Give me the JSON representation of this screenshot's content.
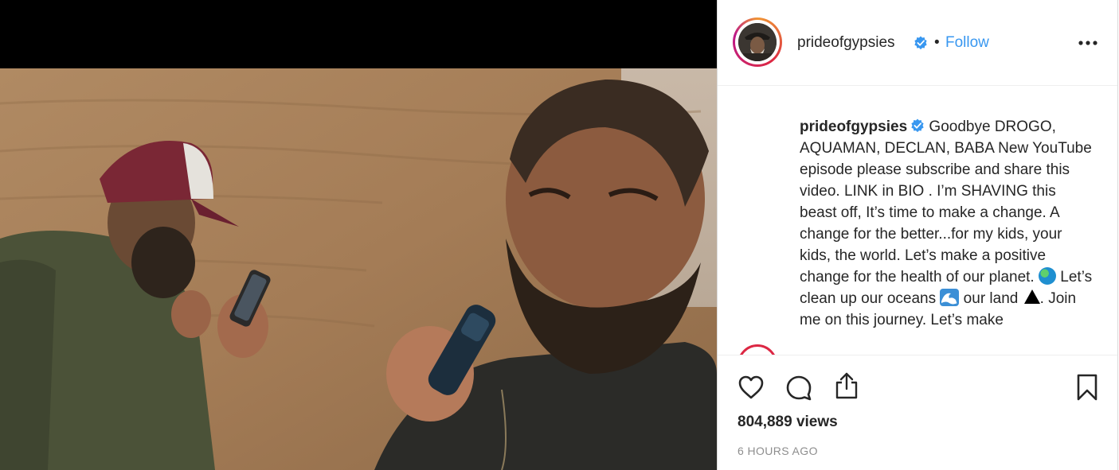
{
  "post": {
    "username": "prideofgypsies",
    "separator": "•",
    "follow_label": "Follow",
    "caption_username": "prideofgypsies",
    "caption_part1": " Goodbye DROGO, AQUAMAN, DECLAN, BABA New YouTube episode please subscribe and share this video. LINK in BIO . I’m SHAVING this beast off, It’s time to make a change. A change for the better...for my kids, your kids, the world. Let’s make a positive change for the health of our planet. ",
    "caption_part2": " Let’s clean up our oceans ",
    "caption_part3": " our land ",
    "caption_part4": ". Join me on this journey. Let’s make",
    "views": "804,889 views",
    "time_ago": "6 HOURS AGO"
  },
  "icons": {
    "verified": "verified-badge-icon",
    "more": "more-options-icon",
    "like": "heart-icon",
    "comment": "comment-icon",
    "share": "share-icon",
    "save": "bookmark-icon",
    "emoji_1": "globe-emoji",
    "emoji_2": "wave-emoji",
    "emoji_3": "triangle-emoji"
  },
  "colors": {
    "link_blue": "#3897f0",
    "verified_blue": "#3897f0",
    "text": "#262626",
    "muted": "#8e8e8e"
  }
}
